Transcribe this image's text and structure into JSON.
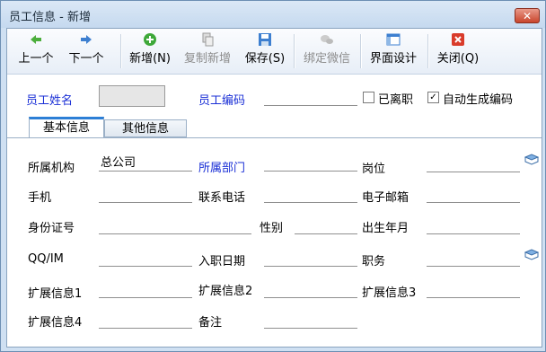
{
  "window": {
    "title": "员工信息 - 新增",
    "close_label": "✕"
  },
  "toolbar": {
    "prev": "上一个",
    "next": "下一个",
    "add": "新增(N)",
    "copy_add": "复制新增",
    "save": "保存(S)",
    "bind_wechat": "绑定微信",
    "ui_design": "界面设计",
    "close": "关闭(Q)"
  },
  "header": {
    "name_label": "员工姓名",
    "name_value": "",
    "code_label": "员工编码",
    "code_value": "",
    "resigned_label": "已离职",
    "resigned_checked": false,
    "auto_code_label": "自动生成编码",
    "auto_code_checked": true
  },
  "tabs": [
    {
      "label": "基本信息",
      "active": true
    },
    {
      "label": "其他信息",
      "active": false
    }
  ],
  "form": {
    "org_label": "所属机构",
    "org_value": "总公司",
    "dept_label": "所属部门",
    "dept_value": "",
    "post_label": "岗位",
    "post_value": "",
    "mobile_label": "手机",
    "mobile_value": "",
    "phone_label": "联系电话",
    "phone_value": "",
    "email_label": "电子邮箱",
    "email_value": "",
    "idcard_label": "身份证号",
    "idcard_value": "",
    "gender_label": "性别",
    "gender_value": "",
    "birth_label": "出生年月",
    "birth_value": "",
    "qq_label": "QQ/IM",
    "qq_value": "",
    "join_label": "入职日期",
    "join_value": "",
    "duty_label": "职务",
    "duty_value": "",
    "ext1_label": "扩展信息1",
    "ext1_value": "",
    "ext2_label": "扩展信息2",
    "ext2_value": "",
    "ext3_label": "扩展信息3",
    "ext3_value": "",
    "ext4_label": "扩展信息4",
    "ext4_value": "",
    "remark_label": "备注",
    "remark_value": ""
  },
  "colors": {
    "accent_blue": "#1a2fd6",
    "tab_accent": "#2d7fd6"
  }
}
